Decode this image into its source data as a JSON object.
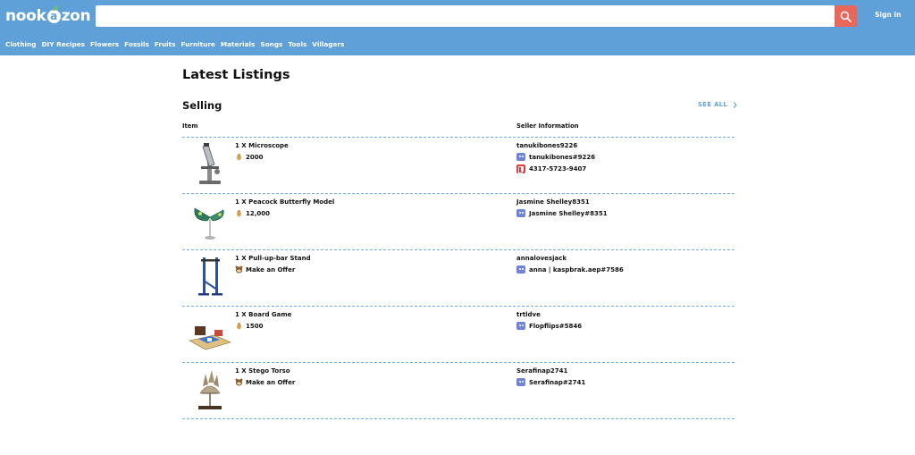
{
  "header": {
    "logo_text_left": "nook",
    "logo_leaf": "a",
    "logo_text_right": "zon",
    "search_placeholder": "",
    "search_icon": "search-icon",
    "signin_label": "Sign In",
    "nav": [
      "Clothing",
      "DIY Recipes",
      "Flowers",
      "Fossils",
      "Fruits",
      "Furniture",
      "Materials",
      "Songs",
      "Tools",
      "Villagers"
    ]
  },
  "main": {
    "title": "Latest Listings",
    "section_title": "Selling",
    "see_all_label": "SEE ALL",
    "col_item": "Item",
    "col_seller": "Seller Information",
    "listings": [
      {
        "item": "1 X Microscope",
        "price_icon": "bell-bag-icon",
        "price": "2000",
        "seller": "tanukibones9226",
        "contacts": [
          {
            "type": "discord",
            "icon": "discord-icon",
            "text": "tanukibones#9226"
          },
          {
            "type": "switch",
            "icon": "nintendo-switch-icon",
            "text": "4317-5723-9407"
          }
        ]
      },
      {
        "item": "1 X Peacock Butterfly Model",
        "price_icon": "bell-bag-icon",
        "price": "12,000",
        "seller": "Jasmine Shelley8351",
        "contacts": [
          {
            "type": "discord",
            "icon": "discord-icon",
            "text": "Jasmine Shelley#8351"
          }
        ]
      },
      {
        "item": "1 X Pull-up-bar Stand",
        "price_icon": "tanuki-icon",
        "price": "Make an Offer",
        "seller": "annalovesjack",
        "contacts": [
          {
            "type": "discord",
            "icon": "discord-icon",
            "text": "anna | kaspbrak.aep#7586"
          }
        ]
      },
      {
        "item": "1 X Board Game",
        "price_icon": "bell-bag-icon",
        "price": "1500",
        "seller": "trtldve",
        "contacts": [
          {
            "type": "discord",
            "icon": "discord-icon",
            "text": "Flopflips#5846"
          }
        ]
      },
      {
        "item": "1 X Stego Torso",
        "price_icon": "tanuki-icon",
        "price": "Make an Offer",
        "seller": "Serafinap2741",
        "contacts": [
          {
            "type": "discord",
            "icon": "discord-icon",
            "text": "Serafinap#2741"
          }
        ]
      }
    ]
  },
  "colors": {
    "header_bg": "#5fa0d8",
    "search_button": "#e8675b",
    "divider": "#6fb0e8",
    "discord": "#6f84d6",
    "switch": "#e23b3b"
  }
}
